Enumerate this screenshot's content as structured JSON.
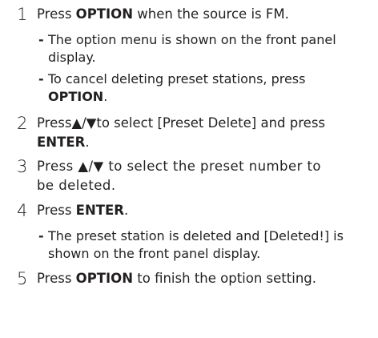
{
  "steps": [
    {
      "num": "1",
      "pre": "Press ",
      "bold": "OPTION",
      "post": " when the source is FM."
    },
    {
      "num": "2",
      "line1_pre": "Press",
      "arrows": "▲/▼",
      "line1_post": "to select [Preset Delete] and press",
      "line2_bold": "ENTER",
      "line2_post": "."
    },
    {
      "num": "3",
      "line1": "Press ▲/▼ to select the preset number to",
      "line2": "be deleted."
    },
    {
      "num": "4",
      "pre": "Press ",
      "bold": "ENTER",
      "post": "."
    },
    {
      "num": "5",
      "pre": "Press ",
      "bold": "OPTION",
      "post": " to finish the option setting."
    }
  ],
  "notes": {
    "step1_note1": {
      "dash": "-",
      "line1": "The option menu is shown on the front panel",
      "line2": "display."
    },
    "step1_note2": {
      "dash": "-",
      "line1": "To cancel deleting preset stations, press",
      "line2_bold": "OPTION",
      "line2_post": "."
    },
    "step4_note1": {
      "dash": "-",
      "line1": "The preset station is deleted and [Deleted!] is",
      "line2": "shown on the front panel display."
    }
  }
}
